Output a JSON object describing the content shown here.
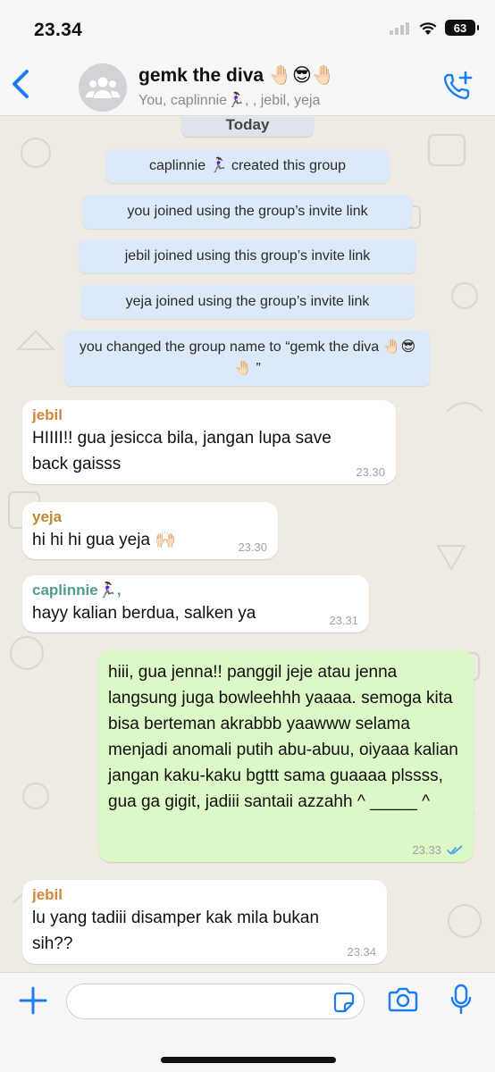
{
  "status": {
    "time": "23.34",
    "battery": "63"
  },
  "header": {
    "group_name": "gemk the diva 🤚🏻😎🤚🏻",
    "members": "You, caplinnie🏃🏻‍♀️, , jebil, yeja"
  },
  "chat": {
    "date_label": "Today",
    "system_messages": [
      "caplinnie 🏃🏻‍♀️ created this group",
      "you joined using the group’s invite link",
      "jebil joined using this group’s invite link",
      "yeja joined using the group’s invite link",
      "you changed the group name to “gemk the diva 🤚🏻😎🤚🏻 ”"
    ],
    "messages": [
      {
        "sender": "jebil",
        "text": "HIIII!! gua jesicca bila, jangan lupa save back gaisss",
        "time": "23.30"
      },
      {
        "sender": "yeja",
        "text": "hi hi hi gua yeja 🙌🏻",
        "time": "23.30"
      },
      {
        "sender": "caplinnie🏃🏻‍♀️,",
        "text": "hayy kalian berdua, salken ya",
        "time": "23.31"
      },
      {
        "sender": "",
        "text": "hiii, gua jenna!! panggil jeje atau jenna langsung juga bowleehhh yaaaa. semoga kita bisa berteman akrabbb yaawww selama menjadi anomali putih abu-abuu, oiyaaa kalian jangan kaku-kaku bgttt sama guaaaa plssss, gua ga gigit, jadiii santaii azzahh ^ _____ ^",
        "time": "23.33"
      },
      {
        "sender": "jebil",
        "text": "lu yang tadiii disamper kak mila bukan sih??",
        "time": "23.34"
      }
    ]
  },
  "colors": {
    "jebil": "#d1873d",
    "yeja": "#b98b2c",
    "caplinnie": "#4f9d8e",
    "accent": "#1a7cf0",
    "outgoing": "#dcf8c6",
    "system": "#dbe9f8"
  }
}
